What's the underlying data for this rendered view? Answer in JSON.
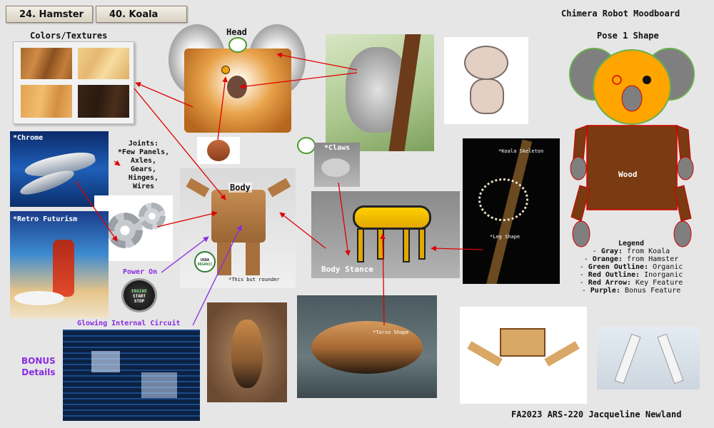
{
  "tabs": [
    "24. Hamster",
    "40. Koala"
  ],
  "title": "Chimera Robot Moodboard",
  "footer": "FA2023 ARS-220 Jacqueline Newland",
  "labels": {
    "colors_textures": "Colors/Textures",
    "head": "Head",
    "pose": "Pose 1 Shape",
    "chrome": "*Chrome",
    "joints": [
      "Joints:",
      "*Few Panels,",
      "Axles,",
      "Gears,",
      "Hinges,",
      "Wires"
    ],
    "retro": "*Retro Futurism",
    "body": "Body",
    "claws": "*Claws",
    "body_stance": "Body Stance",
    "power_on": "Power On",
    "glowing": "Glowing Internal Circuit",
    "bonus": [
      "BONUS",
      "Details"
    ],
    "koala_skeleton": "*Koala Skeleton",
    "leg_shape": "*Leg Shape",
    "torso_shape": "*Torso Shape",
    "rounder": "*This but rounder",
    "wood": "Wood",
    "start_button": [
      "ENGINE",
      "START",
      "STOP"
    ],
    "usda": [
      "USDA",
      "ORGANIC"
    ]
  },
  "legend": {
    "title": "Legend",
    "items": [
      {
        "key": "Gray:",
        "value": "from Koala"
      },
      {
        "key": "Orange:",
        "value": "from Hamster"
      },
      {
        "key": "Green Outline:",
        "value": "Organic"
      },
      {
        "key": "Red Outline:",
        "value": "Inorganic"
      },
      {
        "key": "Red Arrow:",
        "value": "Key Feature"
      },
      {
        "key": "Purple:",
        "value": "Bonus Feature"
      }
    ]
  },
  "colors": {
    "background": "#e6e6e6",
    "arrow_red": "#e00000",
    "arrow_purple": "#8a2be2",
    "robot_gray": "#7f7f7f",
    "robot_orange": "#ffa500",
    "robot_brown": "#7a3a12",
    "outline_green": "#6ab04c",
    "outline_red": "#d40000"
  }
}
